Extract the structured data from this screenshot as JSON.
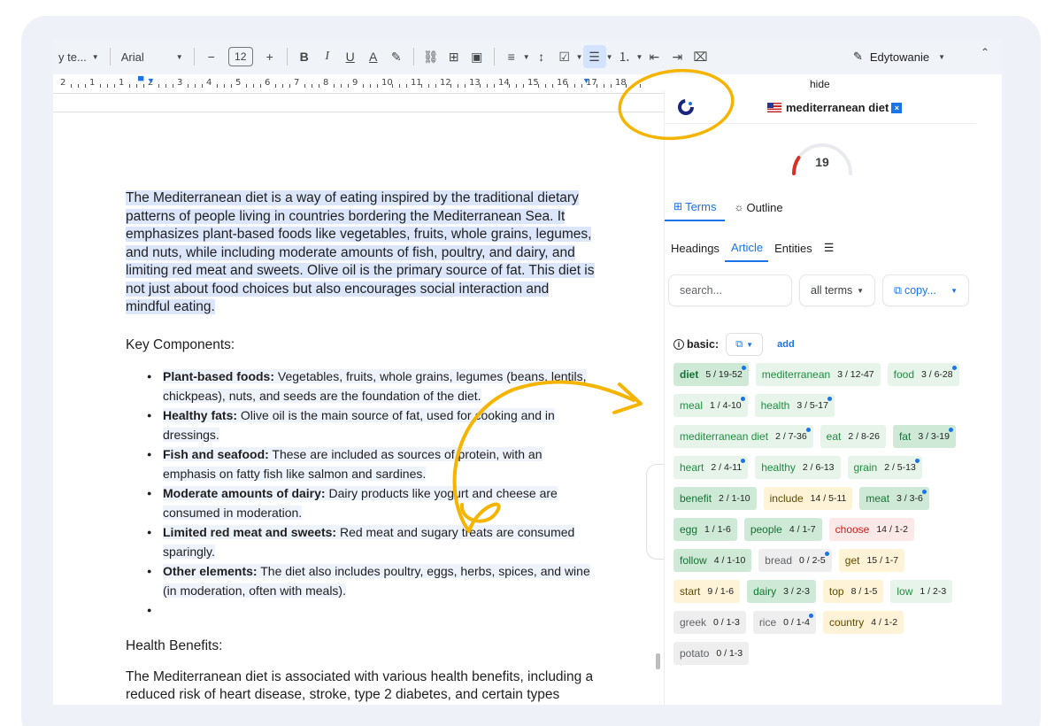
{
  "toolbar": {
    "style_label": "y te...",
    "font_label": "Arial",
    "font_size": "12",
    "minus": "−",
    "plus": "+",
    "bold": "B",
    "italic": "I",
    "underline": "U",
    "text_color": "A",
    "editing_label": "Edytowanie"
  },
  "ruler": {
    "numbers": [
      "2",
      "1",
      "1",
      "2",
      "3",
      "4",
      "5",
      "6",
      "7",
      "8",
      "9",
      "10",
      "11",
      "12",
      "13",
      "14",
      "15",
      "16",
      "17",
      "18"
    ]
  },
  "document": {
    "intro": "The Mediterranean diet is a way of eating inspired by the traditional dietary patterns of people living in countries bordering the Mediterranean Sea. It emphasizes plant-based foods like vegetables, fruits, whole grains, legumes, and nuts, while including moderate amounts of fish, poultry, and dairy, and limiting red meat and sweets. Olive oil is the primary source of fat. This diet is not just about food choices but also encourages social interaction and mindful eating.",
    "key_heading": "Key Components:",
    "bullets": [
      {
        "term": "Plant-based foods:",
        "text": " Vegetables, fruits, whole grains, legumes (beans, lentils, chickpeas), nuts, and seeds are the foundation of the diet."
      },
      {
        "term": "Healthy fats:",
        "text": " Olive oil is the main source of fat, used for cooking and in dressings."
      },
      {
        "term": "Fish and seafood:",
        "text": " These are included as sources of protein, with an emphasis on fatty fish like salmon and sardines."
      },
      {
        "term": "Moderate amounts of dairy:",
        "text": " Dairy products like yogurt and cheese are consumed in moderation."
      },
      {
        "term": "Limited red meat and sweets:",
        "text": " Red meat and sugary treats are consumed sparingly."
      },
      {
        "term": "Other elements:",
        "text": " The diet also includes poultry, eggs, herbs, spices, and wine (in moderation, often with meals)."
      }
    ],
    "health_heading": "Health Benefits:",
    "health_text": "The Mediterranean diet is associated with various health benefits, including a reduced risk of heart disease, stroke, type 2 diabetes, and certain types"
  },
  "panel": {
    "hide_label": "hide",
    "keyword": "mediterranean diet",
    "keyword_remove": "×",
    "score": "19",
    "score_fraction": 0.19,
    "tabs": [
      "Terms",
      "Outline"
    ],
    "subtabs": [
      "Headings",
      "Article",
      "Entities"
    ],
    "search_placeholder": "search...",
    "terms_filter": "all terms",
    "copy_label": "copy...",
    "basic_label": "basic:",
    "add_label": "add",
    "chips": [
      {
        "term": "diet",
        "count": "5 / 19-52",
        "style": "c-g",
        "bold": true,
        "dot": true
      },
      {
        "term": "mediterranean",
        "count": "3 / 12-47",
        "style": "c-lg",
        "bold": false,
        "dot": false
      },
      {
        "term": "food",
        "count": "3 / 6-28",
        "style": "c-lg",
        "bold": false,
        "dot": true
      },
      {
        "term": "meal",
        "count": "1 / 4-10",
        "style": "c-lg",
        "bold": false,
        "dot": true
      },
      {
        "term": "health",
        "count": "3 / 5-17",
        "style": "c-lg",
        "bold": false,
        "dot": true
      },
      {
        "term": "mediterranean diet",
        "count": "2 / 7-36",
        "style": "c-lg",
        "bold": false,
        "dot": true
      },
      {
        "term": "eat",
        "count": "2 / 8-26",
        "style": "c-lg",
        "bold": false,
        "dot": false
      },
      {
        "term": "fat",
        "count": "3 / 3-19",
        "style": "c-g",
        "bold": false,
        "dot": true
      },
      {
        "term": "heart",
        "count": "2 / 4-11",
        "style": "c-lg",
        "bold": false,
        "dot": true
      },
      {
        "term": "healthy",
        "count": "2 / 6-13",
        "style": "c-lg",
        "bold": false,
        "dot": false
      },
      {
        "term": "grain",
        "count": "2 / 5-13",
        "style": "c-lg",
        "bold": false,
        "dot": true
      },
      {
        "term": "benefit",
        "count": "2 / 1-10",
        "style": "c-g",
        "bold": false,
        "dot": false
      },
      {
        "term": "include",
        "count": "14 / 5-11",
        "style": "c-y",
        "bold": false,
        "dot": false
      },
      {
        "term": "meat",
        "count": "3 / 3-6",
        "style": "c-g",
        "bold": false,
        "dot": true
      },
      {
        "term": "egg",
        "count": "1 / 1-6",
        "style": "c-g",
        "bold": false,
        "dot": false
      },
      {
        "term": "people",
        "count": "4 / 1-7",
        "style": "c-g",
        "bold": false,
        "dot": false
      },
      {
        "term": "choose",
        "count": "14 / 1-2",
        "style": "c-r",
        "bold": false,
        "dot": false
      },
      {
        "term": "follow",
        "count": "4 / 1-10",
        "style": "c-g",
        "bold": false,
        "dot": false
      },
      {
        "term": "bread",
        "count": "0 / 2-5",
        "style": "c-gr",
        "bold": false,
        "dot": true
      },
      {
        "term": "get",
        "count": "15 / 1-7",
        "style": "c-y",
        "bold": false,
        "dot": false
      },
      {
        "term": "start",
        "count": "9 / 1-6",
        "style": "c-y",
        "bold": false,
        "dot": false
      },
      {
        "term": "dairy",
        "count": "3 / 2-3",
        "style": "c-g",
        "bold": false,
        "dot": false
      },
      {
        "term": "top",
        "count": "8 / 1-5",
        "style": "c-y",
        "bold": false,
        "dot": false
      },
      {
        "term": "low",
        "count": "1 / 2-3",
        "style": "c-lg",
        "bold": false,
        "dot": false
      },
      {
        "term": "greek",
        "count": "0 / 1-3",
        "style": "c-gr",
        "bold": false,
        "dot": false
      },
      {
        "term": "rice",
        "count": "0 / 1-4",
        "style": "c-gr",
        "bold": false,
        "dot": true
      },
      {
        "term": "country",
        "count": "4 / 1-2",
        "style": "c-y",
        "bold": false,
        "dot": false
      },
      {
        "term": "potato",
        "count": "0 / 1-3",
        "style": "c-gr",
        "bold": false,
        "dot": false
      }
    ]
  },
  "colors": {
    "accent": "#1a73e8",
    "annotation": "#f4b400",
    "gauge_fill": "#d93025"
  }
}
